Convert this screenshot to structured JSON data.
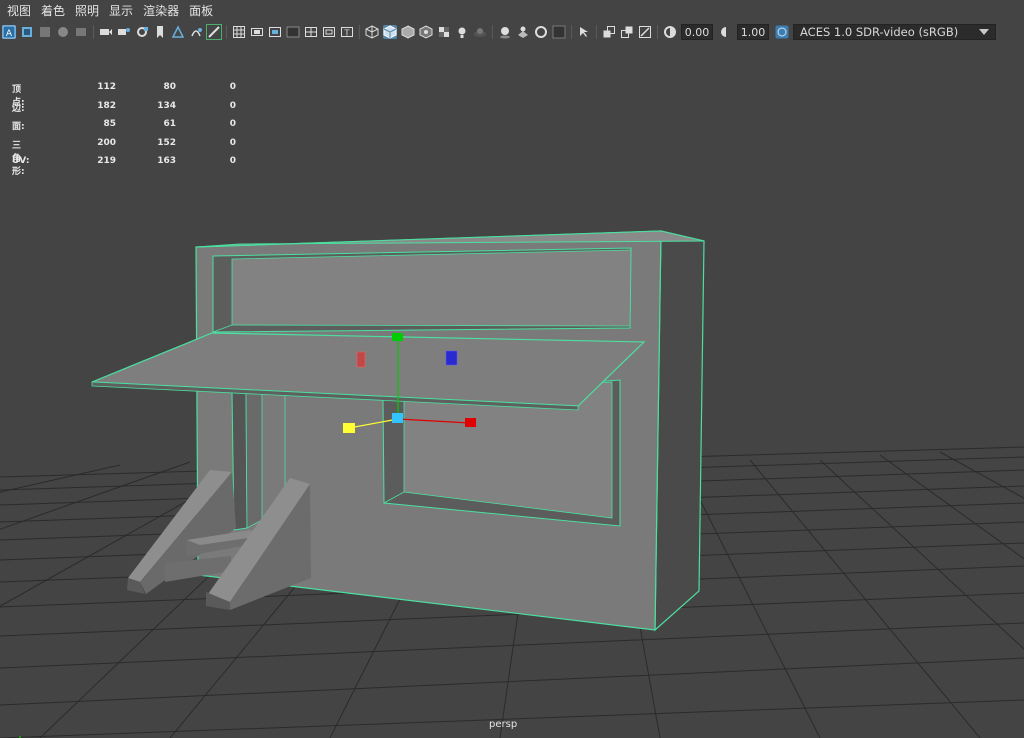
{
  "menu": [
    "视图",
    "着色",
    "照明",
    "显示",
    "渲染器",
    "面板"
  ],
  "toolbar": {
    "icons": [
      "select-camera-icon",
      "lock-camera-icon",
      "bookmarks-icon",
      "image-plane-icon",
      "gate-icon",
      "camera-attributes-icon",
      "film-gate-icon",
      "resolution-gate-icon",
      "gate-mask-icon",
      "field-chart-icon",
      "safe-action-icon",
      "safe-title-icon",
      "grease-pencil-icon",
      "grid-icon",
      "wireframe-icon",
      "smooth-shade-icon",
      "default-material-icon",
      "textured-icon",
      "use-all-lights-icon",
      "shadows-icon",
      "screen-space-ao-icon",
      "motion-blur-icon",
      "anti-aliasing-icon",
      "depth-of-field-icon",
      "isolate-select-icon",
      "xray-icon",
      "xray-active-icon",
      "xray-joints-icon",
      "exposure-icon",
      "gamma-icon"
    ],
    "exposure_value": "0.00",
    "gamma_value": "1.00",
    "color_space": "ACES 1.0 SDR-video (sRGB)"
  },
  "hud": {
    "rows": [
      {
        "label": "顶点:",
        "c1": "112",
        "c2": "80",
        "c3": "0"
      },
      {
        "label": "边:",
        "c1": "182",
        "c2": "134",
        "c3": "0"
      },
      {
        "label": "面:",
        "c1": "85",
        "c2": "61",
        "c3": "0"
      },
      {
        "label": "三角形:",
        "c1": "200",
        "c2": "152",
        "c3": "0"
      },
      {
        "label": "UV:",
        "c1": "219",
        "c2": "163",
        "c3": "0"
      }
    ]
  },
  "viewport": {
    "camera": "persp",
    "background_color": "#444444",
    "grid_color": "#2b2b2b",
    "selection_color": "#4be0a0",
    "mesh_color": "#7a7a7a"
  },
  "gizmo": {
    "x_color": "#e00000",
    "y_color": "#00cc00",
    "z_color": "#1a1ae6",
    "center_color": "#33c4ff",
    "free_color": "#ffff33"
  }
}
